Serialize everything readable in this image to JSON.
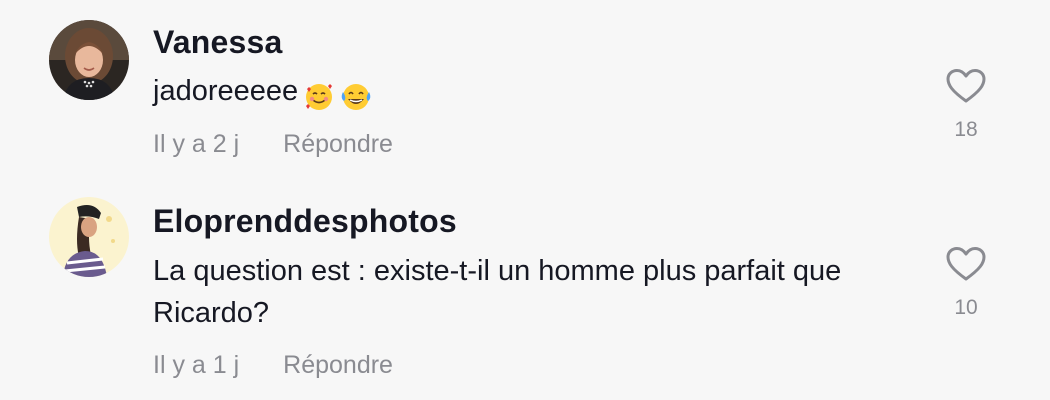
{
  "comments": [
    {
      "username": "Vanessa",
      "text": "jadoreeeee",
      "emojis": [
        "smiling-face-with-hearts",
        "tears-of-joy"
      ],
      "time": "Il y a 2 j",
      "reply_label": "Répondre",
      "likes": "18",
      "avatar_icon": "avatar-photo"
    },
    {
      "username": "Eloprenddesphotos",
      "text": "La question est : existe-t-il un homme plus parfait que Ricardo?",
      "time": "Il y a 1 j",
      "reply_label": "Répondre",
      "likes": "10",
      "avatar_icon": "avatar-illustration"
    }
  ],
  "colors": {
    "background": "#f7f7f7",
    "text": "#161823",
    "muted": "#8a8b91"
  }
}
